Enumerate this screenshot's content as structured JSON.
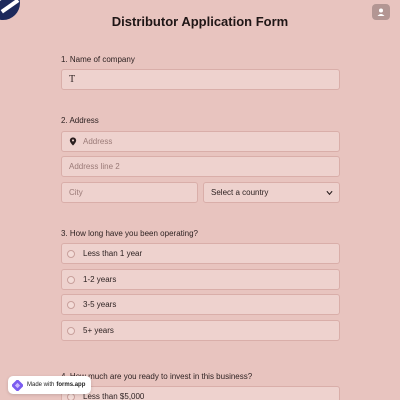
{
  "form": {
    "title": "Distributor Application Form"
  },
  "questions": {
    "q1": {
      "label": "1. Name of company",
      "value": "T"
    },
    "q2": {
      "label": "2. Address",
      "address_placeholder": "Address",
      "address2_placeholder": "Address line 2",
      "city_placeholder": "City",
      "country_value": "Select a country"
    },
    "q3": {
      "label": "3. How long have you been operating?",
      "options": [
        "Less than 1 year",
        "1-2 years",
        "3-5 years",
        "5+ years"
      ]
    },
    "q4": {
      "label": "4. How much are you ready to invest in this business?",
      "options": [
        "Less than $5,000"
      ]
    }
  },
  "badge": {
    "prefix": "Made with",
    "brand": "forms.app"
  },
  "colors": {
    "background": "#e8c4bf",
    "field": "#eed2ce",
    "border": "#d9aea9",
    "logo": "#1d2a5c"
  },
  "icons": {
    "corner": "brand-logo-icon",
    "top_right": "user-icon",
    "address": "location-pin-icon",
    "select": "chevron-down-icon"
  }
}
